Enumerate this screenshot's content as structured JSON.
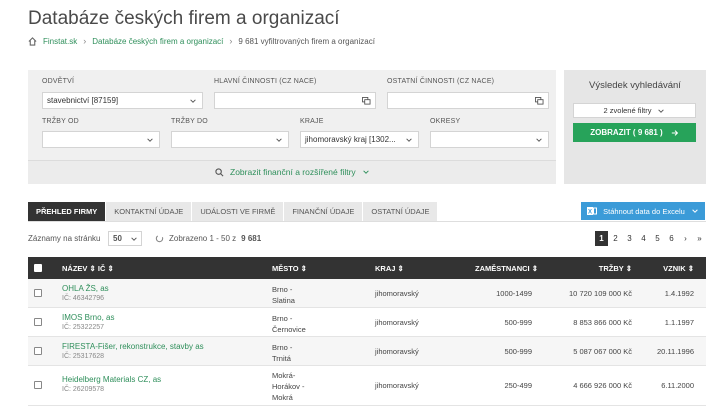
{
  "page": {
    "title": "Databáze českých firem a organizací",
    "breadcrumb": {
      "home": "Finstat.sk",
      "section": "Databáze českých firem a organizací",
      "current": "9 681 vyfiltrovaných firem a organizací"
    }
  },
  "filters": {
    "sector": {
      "label": "ODVĚTVÍ",
      "value": "stavebnictví [87159]"
    },
    "main_activity": {
      "label": "HLAVNÍ ČINNOSTI (CZ NACE)",
      "value": ""
    },
    "other_activity": {
      "label": "OSTATNÍ ČINNOSTI (CZ NACE)",
      "value": ""
    },
    "revenue_from": {
      "label": "TRŽBY OD",
      "value": ""
    },
    "revenue_to": {
      "label": "TRŽBY DO",
      "value": ""
    },
    "region": {
      "label": "KRAJE",
      "value": "jihomoravský kraj [1302..."
    },
    "district": {
      "label": "OKRESY",
      "value": ""
    },
    "advanced_toggle": "Zobrazit finanční a rozšířené filtry"
  },
  "result": {
    "title": "Výsledek vyhledávání",
    "filters_selected": "2 zvolené filtry",
    "show_button": "ZOBRAZIT ( 9 681 )"
  },
  "tabs": [
    "PŘEHLED FIRMY",
    "KONTAKTNÍ ÚDAJE",
    "UDÁLOSTI VE FIRMĚ",
    "FINANČNÍ ÚDAJE",
    "OSTATNÍ ÚDAJE"
  ],
  "excel_button": "Stáhnout data do Excelu",
  "listing": {
    "per_page_label": "Záznamy na stránku",
    "per_page_value": "50",
    "showing_prefix": "Zobrazeno 1 - 50 z",
    "showing_total": "9 681"
  },
  "pagination": [
    "1",
    "2",
    "3",
    "4",
    "5",
    "6",
    "›",
    "»"
  ],
  "table": {
    "headers": {
      "name": "NÁZEV ⇕ IČ ⇕",
      "city": "MĚSTO ⇕",
      "region": "KRAJ ⇕",
      "employees": "ZAMĚSTNANCI ⇕",
      "revenue": "TRŽBY ⇕",
      "founded": "VZNIK ⇕"
    },
    "rows": [
      {
        "name": "OHLA ŽS, as",
        "ico": "IČ: 46342796",
        "city1": "Brno -",
        "city2": "Slatina",
        "city3": "",
        "region": "jihomoravský",
        "employees": "1000-1499",
        "revenue": "10 720 109 000 Kč",
        "founded": "1.4.1992"
      },
      {
        "name": "IMOS Brno, as",
        "ico": "IČ: 25322257",
        "city1": "Brno -",
        "city2": "Černovice",
        "city3": "",
        "region": "jihomoravský",
        "employees": "500-999",
        "revenue": "8 853 866 000 Kč",
        "founded": "1.1.1997"
      },
      {
        "name": "FIRESTA-Fišer, rekonstrukce, stavby as",
        "ico": "IČ: 25317628",
        "city1": "Brno -",
        "city2": "Trnitá",
        "city3": "",
        "region": "jihomoravský",
        "employees": "500-999",
        "revenue": "5 087 067 000 Kč",
        "founded": "20.11.1996"
      },
      {
        "name": "Heidelberg Materials CZ, as",
        "ico": "IČ: 26209578",
        "city1": "Mokrá-",
        "city2": "Horákov -",
        "city3": "Mokrá",
        "region": "jihomoravský",
        "employees": "250-499",
        "revenue": "4 666 926 000 Kč",
        "founded": "6.11.2000"
      }
    ]
  },
  "colors": {
    "accent_green": "#27a35a",
    "link_green": "#2f8f5b",
    "dark_header": "#333333",
    "excel_blue": "#3b9bd8"
  }
}
